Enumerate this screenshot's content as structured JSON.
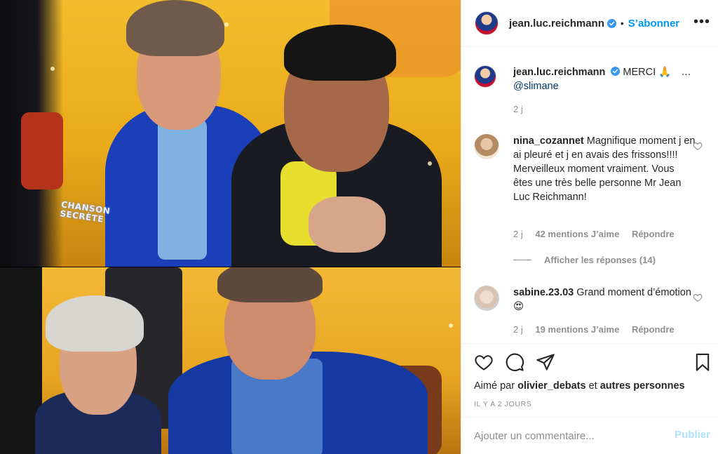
{
  "post": {
    "author": "jean.luc.reichmann",
    "follow_label": "S’abonner",
    "caption_text": "MERCI 🙏",
    "caption_more": "…",
    "caption_mention": "@slimane",
    "caption_time": "2 j",
    "tv_logo_line1": "CHANSON",
    "tv_logo_line2": "SECRÈTE"
  },
  "comments": [
    {
      "user": "nina_cozannet",
      "text": "Magnifique moment j en ai pleuré et j en avais des frissons!!!! Merveilleux moment vraiment. Vous êtes une très belle personne Mr Jean Luc Reichmann!",
      "time": "2 j",
      "likes": "42 mentions J’aime",
      "reply": "Répondre",
      "view_replies": "Afficher les réponses (14)"
    },
    {
      "user": "sabine.23.03",
      "text": "Grand moment d’émotion 😍",
      "time": "2 j",
      "likes": "19 mentions J’aime",
      "reply": "Répondre"
    }
  ],
  "actions": {
    "liked_by_prefix": "Aimé par",
    "liked_by_user": "olivier_debats",
    "liked_by_and": "et",
    "liked_by_others": "autres personnes",
    "date": "IL Y A 2 JOURS"
  },
  "composer": {
    "placeholder": "Ajouter un commentaire...",
    "publish_label": "Publier"
  },
  "icons": {
    "verified": "verified-badge-icon",
    "like": "heart-icon",
    "comment": "comment-icon",
    "share": "paper-plane-icon",
    "save": "bookmark-icon",
    "more": "more-dots-icon"
  },
  "colors": {
    "link_blue": "#0095f6",
    "publish_disabled": "#b2dffc",
    "muted": "#8e8e8e",
    "text": "#262626"
  }
}
